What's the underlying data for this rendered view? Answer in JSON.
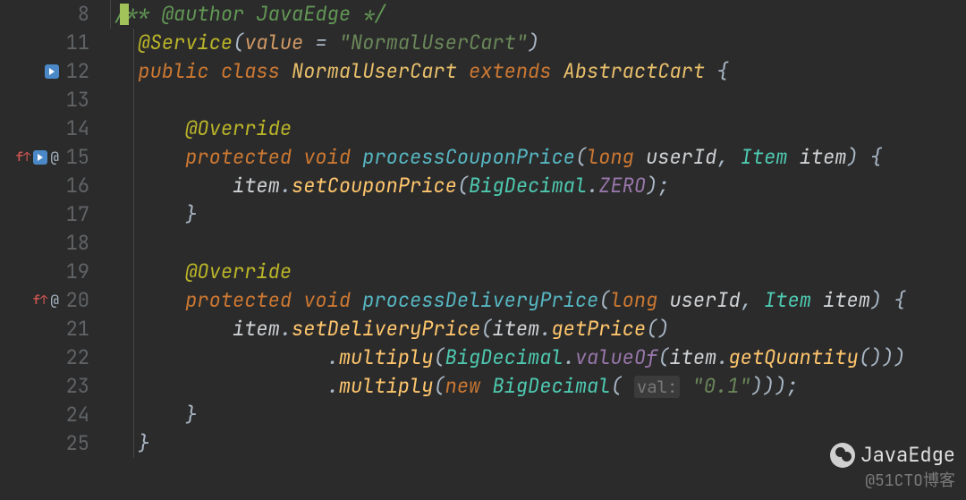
{
  "gutter": {
    "lines": [
      "8",
      "11",
      "12",
      "13",
      "14",
      "15",
      "16",
      "17",
      "18",
      "19",
      "20",
      "21",
      "22",
      "23",
      "24",
      "25"
    ]
  },
  "code": {
    "l8": {
      "comment_open": "/** ",
      "tag": "@author",
      "rest": " JavaEdge */"
    },
    "l11": {
      "annot": "@Service",
      "lp": "(",
      "arg": "value ",
      "eq": "= ",
      "str": "\"NormalUserCart\"",
      "rp": ")"
    },
    "l12": {
      "kw1": "public ",
      "kw2": "class ",
      "cls": "NormalUserCart ",
      "kw3": "extends ",
      "sup": "AbstractCart ",
      "brace": "{"
    },
    "l14": {
      "annot": "@Override"
    },
    "l15": {
      "kw1": "protected ",
      "kw2": "void ",
      "m": "processCouponPrice",
      "lp": "(",
      "t1": "long ",
      "p1": "userId",
      "c1": ", ",
      "t2": "Item ",
      "p2": "item",
      "rp": ") {"
    },
    "l16": {
      "obj": "item",
      "dot1": ".",
      "m1": "setCouponPrice",
      "lp": "(",
      "cls": "BigDecimal",
      "dot2": ".",
      "cst": "ZERO",
      "rp": ");"
    },
    "l17": {
      "brace": "}"
    },
    "l19": {
      "annot": "@Override"
    },
    "l20": {
      "kw1": "protected ",
      "kw2": "void ",
      "m": "processDeliveryPrice",
      "lp": "(",
      "t1": "long ",
      "p1": "userId",
      "c1": ", ",
      "t2": "Item ",
      "p2": "item",
      "rp": ") {"
    },
    "l21": {
      "obj": "item",
      "dot1": ".",
      "m1": "setDeliveryPrice",
      "lp": "(",
      "obj2": "item",
      "dot2": ".",
      "m2": "getPrice",
      "rp": "()"
    },
    "l22": {
      "dot": ".",
      "m": "multiply",
      "lp": "(",
      "cls": "BigDecimal",
      "dot2": ".",
      "sm": "valueOf",
      "lp2": "(",
      "obj": "item",
      "dot3": ".",
      "m2": "getQuantity",
      "rp": "()))"
    },
    "l23": {
      "dot": ".",
      "m": "multiply",
      "lp": "(",
      "kw": "new ",
      "cls": "BigDecimal",
      "lp2": "( ",
      "hint": "val:",
      "str": "\"0.1\"",
      "rp": ")));"
    },
    "l24": {
      "brace": "}"
    },
    "l25": {
      "brace": "}"
    }
  },
  "watermark": {
    "name": "JavaEdge",
    "site": "@51CTO博客"
  }
}
